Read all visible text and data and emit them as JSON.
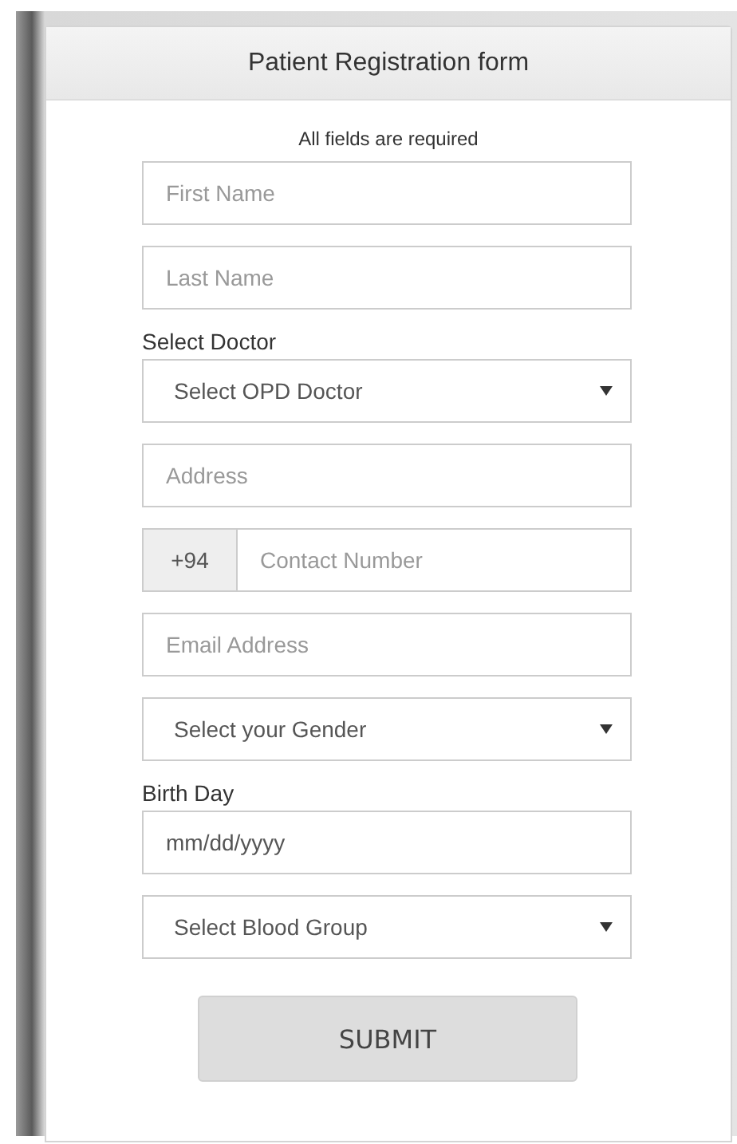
{
  "form": {
    "title": "Patient Registration form",
    "note": "All fields are required",
    "fields": [
      {
        "kind": "text",
        "placeholder": "First Name"
      },
      {
        "kind": "text",
        "placeholder": "Last Name"
      },
      {
        "kind": "select",
        "label": "Select Doctor",
        "value": "Select OPD Doctor"
      },
      {
        "kind": "text",
        "placeholder": "Address"
      },
      {
        "kind": "addon",
        "prefix": "+94",
        "placeholder": "Contact Number"
      },
      {
        "kind": "text",
        "placeholder": "Email Address"
      },
      {
        "kind": "select",
        "value": "Select your Gender"
      },
      {
        "kind": "date",
        "label": "Birth Day",
        "value": "mm/dd/yyyy"
      },
      {
        "kind": "select",
        "value": "Select Blood Group"
      }
    ],
    "submit": "SUBMIT"
  }
}
